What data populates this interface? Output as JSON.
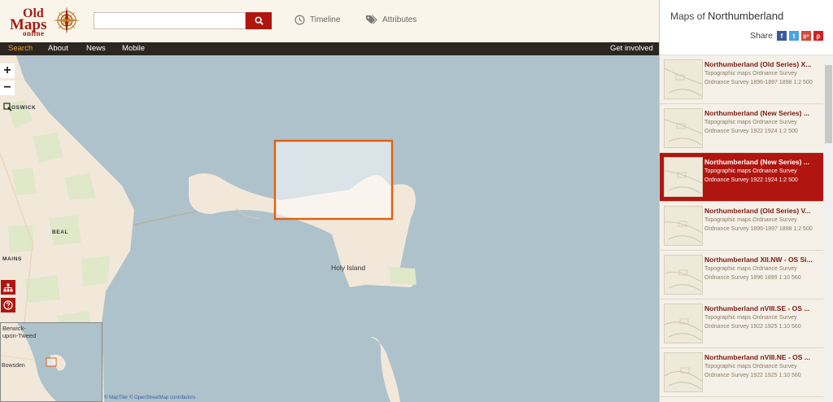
{
  "brand": {
    "line1": "Old",
    "line2": "Maps",
    "line3": "online"
  },
  "search": {
    "placeholder": "",
    "value": ""
  },
  "header_links": {
    "timeline": "Timeline",
    "attributes": "Attributes"
  },
  "nav": {
    "items": [
      "Search",
      "About",
      "News",
      "Mobile"
    ],
    "right": "Get involved"
  },
  "map": {
    "labels": {
      "holy_island": "Holy Island",
      "goswick": "OSWICK",
      "beal": "BEAL",
      "mains": "MAINS"
    },
    "minimap": {
      "berwick": "Berwick-\nupon-Tweed",
      "bowsden": "Bowsden"
    },
    "copyright": "© MapTiler © OpenStreetMap contributors",
    "zoom_in": "+",
    "zoom_out": "−"
  },
  "panel": {
    "title_prefix": "Maps of ",
    "title_place": "Northumberland",
    "share_label": "Share",
    "results": [
      {
        "title": "Northumberland (Old Series) X...",
        "desc": "Topographic maps Ordnance Survey Ordnance Survey 1896-1897 1898 1:2 500",
        "selected": false
      },
      {
        "title": "Northumberland (New Series) ...",
        "desc": "Topographic maps Ordnance Survey Ordnance Survey 1922 1924 1:2 500",
        "selected": false
      },
      {
        "title": "Northumberland (New Series) ...",
        "desc": "Topographic maps Ordnance Survey Ordnance Survey 1922 1924 1:2 500",
        "selected": true
      },
      {
        "title": "Northumberland (Old Series) V...",
        "desc": "Topographic maps Ordnance Survey Ordnance Survey 1896-1897 1898 1:2 500",
        "selected": false
      },
      {
        "title": "Northumberland XII.NW - OS Si...",
        "desc": "Topographic maps Ordnance Survey Ordnance Survey 1896 1899 1:10 560",
        "selected": false
      },
      {
        "title": "Northumberland nVIII.SE - OS ...",
        "desc": "Topographic maps Ordnance Survey Ordnance Survey 1922 1925 1:10 560",
        "selected": false
      },
      {
        "title": "Northumberland nVIII.NE - OS ...",
        "desc": "Topographic maps Ordnance Survey Ordnance Survey 1922 1925 1:10 560",
        "selected": false
      }
    ]
  },
  "colors": {
    "accent": "#b0160f",
    "sea": "#aec2cb",
    "land": "#f2e8da",
    "nav_bg": "#2c2622",
    "nav_active": "#e8a432",
    "highlight": "#e0600f"
  }
}
